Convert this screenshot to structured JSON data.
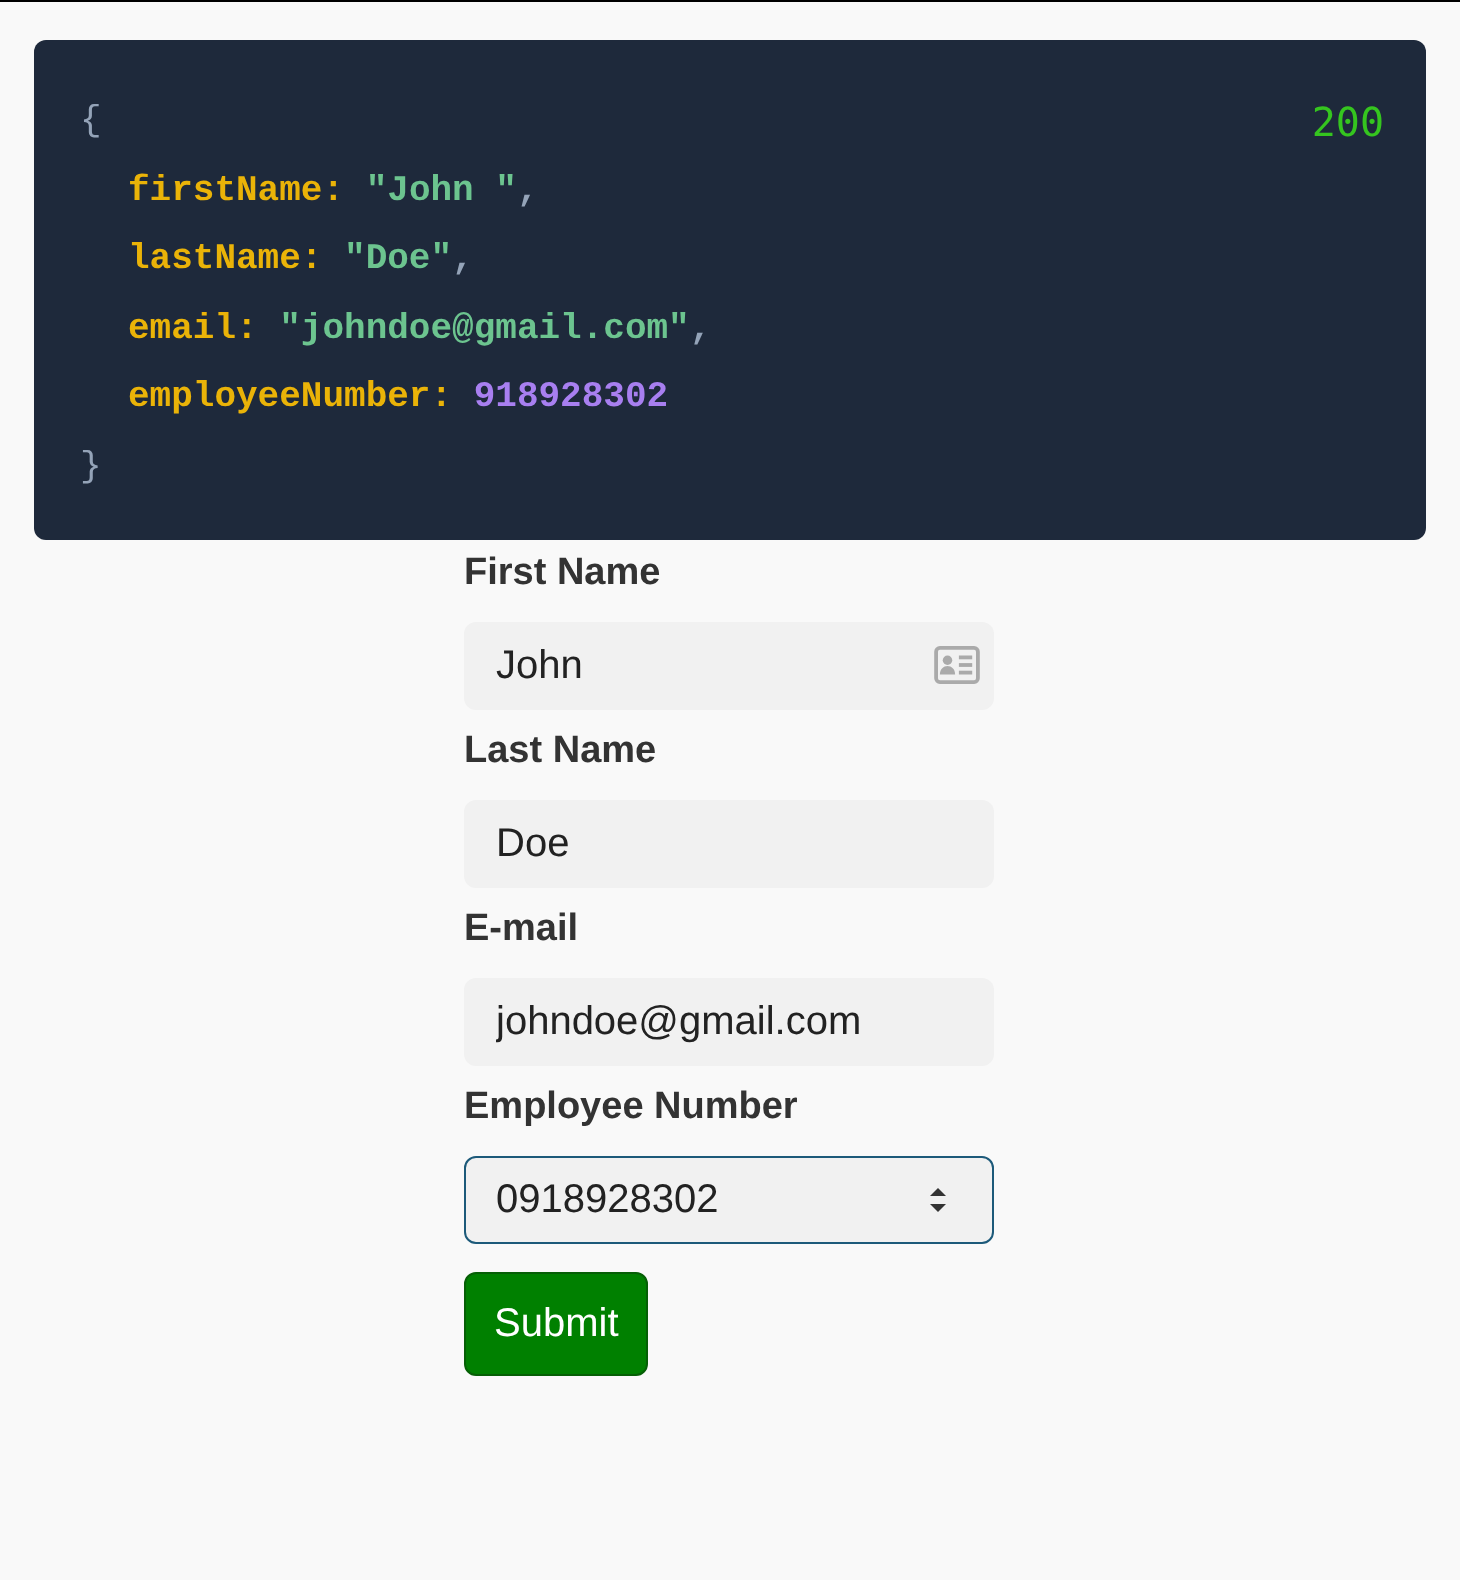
{
  "response": {
    "status": "200",
    "open_brace": "{",
    "close_brace": "}",
    "lines": [
      {
        "key": "firstName:",
        "value": "\"John \"",
        "kind": "string",
        "punct": ","
      },
      {
        "key": "lastName:",
        "value": "\"Doe\"",
        "kind": "string",
        "punct": ","
      },
      {
        "key": "email:",
        "value": "\"johndoe@gmail.com\"",
        "kind": "string",
        "punct": ","
      },
      {
        "key": "employeeNumber:",
        "value": "918928302",
        "kind": "number"
      }
    ]
  },
  "form": {
    "fields": [
      {
        "label": "First Name",
        "value": "John",
        "kind": "contact",
        "focused": false
      },
      {
        "label": "Last Name",
        "value": "Doe",
        "kind": "text",
        "focused": false
      },
      {
        "label": "E-mail",
        "value": "johndoe@gmail.com",
        "kind": "email",
        "focused": false
      },
      {
        "label": "Employee Number",
        "value": "0918928302",
        "kind": "number",
        "focused": true
      }
    ],
    "submit": "Submit"
  }
}
